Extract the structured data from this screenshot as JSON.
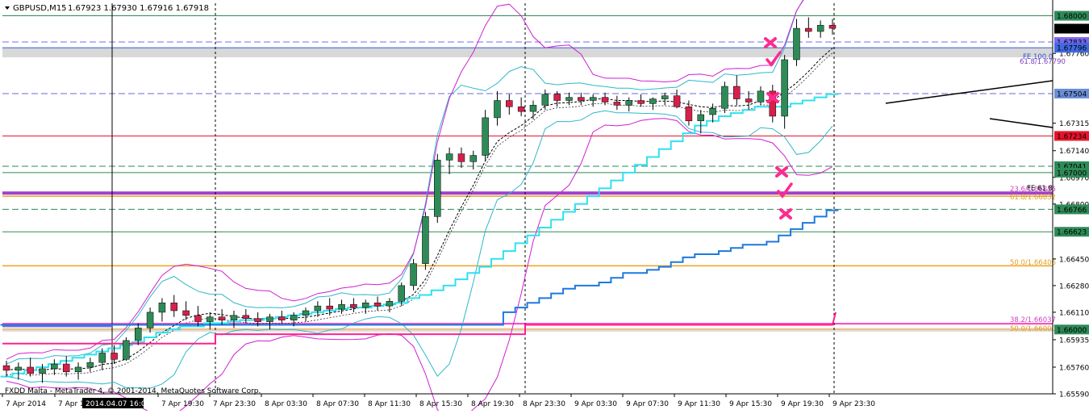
{
  "header": {
    "symbol_label": "GBPUSD,M15",
    "ohlc": "1.67923 1.67930 1.67916 1.67918"
  },
  "footer": {
    "broker": "FXDD Malta - MetaTrader 4, © 2001-2014, MetaQuotes Software Corp."
  },
  "crosshair_time": "2014.04.07 16:00",
  "chart_data": {
    "type": "candlestick",
    "ylim": [
      1.6559,
      1.6808
    ],
    "grid": false,
    "x_ticks": [
      "7 Apr 2014",
      "7 Apr 1",
      "7 Apr 19:30",
      "7 Apr 23:30",
      "8 Apr 03:30",
      "8 Apr 07:30",
      "8 Apr 11:30",
      "8 Apr 15:30",
      "8 Apr 19:30",
      "8 Apr 23:30",
      "9 Apr 03:30",
      "9 Apr 07:30",
      "9 Apr 11:30",
      "9 Apr 15:30",
      "9 Apr 19:30",
      "9 Apr 23:30"
    ],
    "y_ticks": [
      "1.67760",
      "1.67315",
      "1.67140",
      "1.66970",
      "1.66800",
      "1.66450",
      "1.66280",
      "1.66110",
      "1.65935",
      "1.65760",
      "1.65590"
    ],
    "price_boxes": [
      {
        "label": "1.68000",
        "bg": "#2e8b57",
        "fg": "#ffffff"
      },
      {
        "label": "1.67918",
        "bg": "#000000",
        "fg": "#ffffff"
      },
      {
        "label": "1.67833",
        "bg": "#7b68ee",
        "fg": "#ffffff"
      },
      {
        "label": "1.67796",
        "bg": "#4169e1",
        "fg": "#ffffff"
      },
      {
        "label": "1.67504",
        "bg": "#6a8fd8",
        "fg": "#ffffff"
      },
      {
        "label": "1.67234",
        "bg": "#e8132b",
        "fg": "#ffffff"
      },
      {
        "label": "1.67041",
        "bg": "#2e8b57",
        "fg": "#ffffff"
      },
      {
        "label": "1.67000",
        "bg": "#2e8b57",
        "fg": "#ffffff"
      },
      {
        "label": "1.66766",
        "bg": "#2e8b57",
        "fg": "#ffffff"
      },
      {
        "label": "1.66623",
        "bg": "#2e8b57",
        "fg": "#ffffff"
      },
      {
        "label": "1.66000",
        "bg": "#2e8b57",
        "fg": "#ffffff"
      }
    ],
    "h_levels": [
      {
        "price": 1.68,
        "color": "#2e8b57",
        "dash": false,
        "width": 1
      },
      {
        "price": 1.67833,
        "color": "#7b68ee",
        "dash": true,
        "width": 1
      },
      {
        "price": 1.67796,
        "color": "#4169e1",
        "dash": false,
        "width": 1
      },
      {
        "price": 1.67504,
        "color": "#6a6ad8",
        "dash": true,
        "width": 1
      },
      {
        "price": 1.67234,
        "color": "#e8132b",
        "dash": false,
        "width": 1
      },
      {
        "price": 1.67041,
        "color": "#2e8b57",
        "dash": true,
        "width": 1
      },
      {
        "price": 1.67,
        "color": "#2e8b57",
        "dash": false,
        "width": 1
      },
      {
        "price": 1.66766,
        "color": "#2e8b57",
        "dash": true,
        "width": 1
      },
      {
        "price": 1.66623,
        "color": "#2e8b57",
        "dash": false,
        "width": 1
      },
      {
        "price": 1.66406,
        "color": "#f0a020",
        "dash": false,
        "width": 1.5
      },
      {
        "price": 1.6685,
        "color": "#f0a020",
        "dash": false,
        "width": 1.5
      },
      {
        "price": 1.6687,
        "color": "#a040d0",
        "dash": false,
        "width": 4
      },
      {
        "price": 1.66,
        "color": "#f0c080",
        "dash": false,
        "width": 2
      },
      {
        "price": 1.66037,
        "color": "#ff40c0",
        "dash": false,
        "width": 2
      }
    ],
    "fib_labels": [
      "FE 100.0",
      "61.8/1.67790",
      "23.6/1.66855",
      "61.8/1.66832",
      "FE 61.8",
      "50.0/1.66406",
      "38.2/1.66037",
      "50.0/1.66000"
    ],
    "candles": [
      {
        "o": 1.6577,
        "h": 1.658,
        "l": 1.657,
        "c": 1.6574
      },
      {
        "o": 1.6574,
        "h": 1.6579,
        "l": 1.6568,
        "c": 1.6576
      },
      {
        "o": 1.6576,
        "h": 1.6582,
        "l": 1.657,
        "c": 1.6572
      },
      {
        "o": 1.6572,
        "h": 1.6578,
        "l": 1.6566,
        "c": 1.6575
      },
      {
        "o": 1.6575,
        "h": 1.6581,
        "l": 1.6571,
        "c": 1.6578
      },
      {
        "o": 1.6578,
        "h": 1.6583,
        "l": 1.657,
        "c": 1.6573
      },
      {
        "o": 1.6573,
        "h": 1.6579,
        "l": 1.6568,
        "c": 1.6576
      },
      {
        "o": 1.6576,
        "h": 1.6582,
        "l": 1.6573,
        "c": 1.6579
      },
      {
        "o": 1.6579,
        "h": 1.6588,
        "l": 1.6574,
        "c": 1.6585
      },
      {
        "o": 1.6585,
        "h": 1.659,
        "l": 1.6578,
        "c": 1.6581
      },
      {
        "o": 1.6581,
        "h": 1.6595,
        "l": 1.658,
        "c": 1.6593
      },
      {
        "o": 1.6593,
        "h": 1.6604,
        "l": 1.659,
        "c": 1.6601
      },
      {
        "o": 1.6601,
        "h": 1.6614,
        "l": 1.6598,
        "c": 1.6611
      },
      {
        "o": 1.6611,
        "h": 1.662,
        "l": 1.6605,
        "c": 1.6617
      },
      {
        "o": 1.6617,
        "h": 1.6622,
        "l": 1.6608,
        "c": 1.6612
      },
      {
        "o": 1.6612,
        "h": 1.6618,
        "l": 1.6606,
        "c": 1.6609
      },
      {
        "o": 1.6609,
        "h": 1.6615,
        "l": 1.6602,
        "c": 1.6605
      },
      {
        "o": 1.6605,
        "h": 1.6611,
        "l": 1.66,
        "c": 1.6608
      },
      {
        "o": 1.6608,
        "h": 1.6613,
        "l": 1.6603,
        "c": 1.6606
      },
      {
        "o": 1.6606,
        "h": 1.6612,
        "l": 1.6601,
        "c": 1.6609
      },
      {
        "o": 1.6609,
        "h": 1.6613,
        "l": 1.6604,
        "c": 1.6607
      },
      {
        "o": 1.6607,
        "h": 1.6611,
        "l": 1.6602,
        "c": 1.6605
      },
      {
        "o": 1.6605,
        "h": 1.661,
        "l": 1.66,
        "c": 1.6608
      },
      {
        "o": 1.6608,
        "h": 1.6612,
        "l": 1.6604,
        "c": 1.6606
      },
      {
        "o": 1.6606,
        "h": 1.6611,
        "l": 1.6602,
        "c": 1.6609
      },
      {
        "o": 1.6609,
        "h": 1.6614,
        "l": 1.6605,
        "c": 1.6612
      },
      {
        "o": 1.6612,
        "h": 1.6618,
        "l": 1.6608,
        "c": 1.6615
      },
      {
        "o": 1.6615,
        "h": 1.662,
        "l": 1.6609,
        "c": 1.6613
      },
      {
        "o": 1.6613,
        "h": 1.6619,
        "l": 1.661,
        "c": 1.6616
      },
      {
        "o": 1.6616,
        "h": 1.662,
        "l": 1.6611,
        "c": 1.6614
      },
      {
        "o": 1.6614,
        "h": 1.6619,
        "l": 1.661,
        "c": 1.6617
      },
      {
        "o": 1.6617,
        "h": 1.6621,
        "l": 1.6612,
        "c": 1.6615
      },
      {
        "o": 1.6615,
        "h": 1.662,
        "l": 1.6611,
        "c": 1.6618
      },
      {
        "o": 1.6618,
        "h": 1.663,
        "l": 1.6615,
        "c": 1.6628
      },
      {
        "o": 1.6628,
        "h": 1.6645,
        "l": 1.6625,
        "c": 1.6642
      },
      {
        "o": 1.6642,
        "h": 1.6675,
        "l": 1.6638,
        "c": 1.6672
      },
      {
        "o": 1.6672,
        "h": 1.6712,
        "l": 1.6668,
        "c": 1.6708
      },
      {
        "o": 1.6708,
        "h": 1.6716,
        "l": 1.6699,
        "c": 1.6712
      },
      {
        "o": 1.6712,
        "h": 1.6716,
        "l": 1.6703,
        "c": 1.6707
      },
      {
        "o": 1.6707,
        "h": 1.6714,
        "l": 1.6702,
        "c": 1.6711
      },
      {
        "o": 1.6711,
        "h": 1.674,
        "l": 1.6708,
        "c": 1.6735
      },
      {
        "o": 1.6735,
        "h": 1.6752,
        "l": 1.673,
        "c": 1.6746
      },
      {
        "o": 1.6746,
        "h": 1.675,
        "l": 1.6737,
        "c": 1.6742
      },
      {
        "o": 1.6742,
        "h": 1.6748,
        "l": 1.6736,
        "c": 1.6739
      },
      {
        "o": 1.6739,
        "h": 1.6746,
        "l": 1.6734,
        "c": 1.6743
      },
      {
        "o": 1.6743,
        "h": 1.6753,
        "l": 1.674,
        "c": 1.675
      },
      {
        "o": 1.675,
        "h": 1.6752,
        "l": 1.6742,
        "c": 1.6746
      },
      {
        "o": 1.6746,
        "h": 1.6751,
        "l": 1.6743,
        "c": 1.6748
      },
      {
        "o": 1.6748,
        "h": 1.6751,
        "l": 1.6743,
        "c": 1.6746
      },
      {
        "o": 1.6746,
        "h": 1.675,
        "l": 1.6742,
        "c": 1.6748
      },
      {
        "o": 1.6748,
        "h": 1.6751,
        "l": 1.6743,
        "c": 1.6745
      },
      {
        "o": 1.6745,
        "h": 1.6749,
        "l": 1.674,
        "c": 1.6743
      },
      {
        "o": 1.6743,
        "h": 1.6748,
        "l": 1.6739,
        "c": 1.6746
      },
      {
        "o": 1.6746,
        "h": 1.675,
        "l": 1.6742,
        "c": 1.6744
      },
      {
        "o": 1.6744,
        "h": 1.6748,
        "l": 1.674,
        "c": 1.6747
      },
      {
        "o": 1.6747,
        "h": 1.6751,
        "l": 1.6743,
        "c": 1.6749
      },
      {
        "o": 1.6749,
        "h": 1.6753,
        "l": 1.6741,
        "c": 1.6742
      },
      {
        "o": 1.6742,
        "h": 1.6746,
        "l": 1.673,
        "c": 1.6733
      },
      {
        "o": 1.6733,
        "h": 1.674,
        "l": 1.6725,
        "c": 1.6737
      },
      {
        "o": 1.6737,
        "h": 1.6744,
        "l": 1.6732,
        "c": 1.6741
      },
      {
        "o": 1.6741,
        "h": 1.6758,
        "l": 1.6738,
        "c": 1.6755
      },
      {
        "o": 1.6755,
        "h": 1.6762,
        "l": 1.6743,
        "c": 1.6747
      },
      {
        "o": 1.6747,
        "h": 1.6752,
        "l": 1.674,
        "c": 1.6745
      },
      {
        "o": 1.6745,
        "h": 1.6755,
        "l": 1.6743,
        "c": 1.6752
      },
      {
        "o": 1.6752,
        "h": 1.6756,
        "l": 1.6732,
        "c": 1.6736
      },
      {
        "o": 1.6736,
        "h": 1.6775,
        "l": 1.6728,
        "c": 1.6772
      },
      {
        "o": 1.6772,
        "h": 1.6798,
        "l": 1.6768,
        "c": 1.6792
      },
      {
        "o": 1.6792,
        "h": 1.6799,
        "l": 1.6786,
        "c": 1.679
      },
      {
        "o": 1.679,
        "h": 1.6797,
        "l": 1.6786,
        "c": 1.6794
      },
      {
        "o": 1.6794,
        "h": 1.6798,
        "l": 1.6788,
        "c": 1.6792
      }
    ],
    "stair_cyan": [
      1.657,
      1.6572,
      1.6574,
      1.6576,
      1.6578,
      1.658,
      1.6582,
      1.6584,
      1.6586,
      1.6588,
      1.659,
      1.6592,
      1.6595,
      1.6598,
      1.66,
      1.6602,
      1.6602,
      1.6604,
      1.6604,
      1.6605,
      1.6606,
      1.6606,
      1.6607,
      1.6608,
      1.6609,
      1.661,
      1.6611,
      1.6612,
      1.6613,
      1.6614,
      1.6614,
      1.6615,
      1.6616,
      1.6617,
      1.662,
      1.6622,
      1.6625,
      1.6628,
      1.6632,
      1.6636,
      1.664,
      1.6645,
      1.665,
      1.6655,
      1.666,
      1.6665,
      1.667,
      1.6675,
      1.668,
      1.6685,
      1.669,
      1.6695,
      1.67,
      1.6705,
      1.671,
      1.6715,
      1.672,
      1.6725,
      1.673,
      1.6733,
      1.6736,
      1.6738,
      1.674,
      1.6742,
      1.6742,
      1.6742,
      1.6744,
      1.6746,
      1.6748,
      1.675
    ],
    "stair_blue": [
      1.6603,
      1.6603,
      1.6603,
      1.6603,
      1.6603,
      1.6603,
      1.6603,
      1.6603,
      1.6603,
      1.6603,
      1.6603,
      1.6603,
      1.6603,
      1.6603,
      1.6603,
      1.6603,
      1.6603,
      1.6603,
      1.6603,
      1.6603,
      1.6603,
      1.6603,
      1.6603,
      1.6603,
      1.6603,
      1.6603,
      1.6603,
      1.6603,
      1.6603,
      1.6603,
      1.6603,
      1.6603,
      1.6603,
      1.6603,
      1.6603,
      1.6603,
      1.6603,
      1.6603,
      1.6603,
      1.6603,
      1.6603,
      1.6603,
      1.6611,
      1.6614,
      1.6617,
      1.662,
      1.6623,
      1.6626,
      1.6628,
      1.6628,
      1.663,
      1.6633,
      1.6636,
      1.6636,
      1.6638,
      1.664,
      1.6643,
      1.6646,
      1.6648,
      1.6648,
      1.665,
      1.6652,
      1.6654,
      1.6654,
      1.6656,
      1.666,
      1.6664,
      1.6668,
      1.6672,
      1.6676
    ]
  }
}
